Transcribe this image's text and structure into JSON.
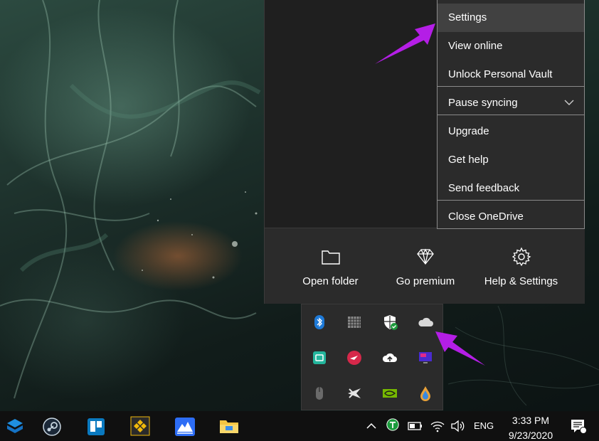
{
  "onedrive_menu": {
    "items": [
      {
        "label": "Settings"
      },
      {
        "label": "View online"
      },
      {
        "label": "Unlock Personal Vault"
      },
      {
        "label": "Pause syncing"
      },
      {
        "label": "Upgrade"
      },
      {
        "label": "Get help"
      },
      {
        "label": "Send feedback"
      },
      {
        "label": "Close OneDrive"
      }
    ]
  },
  "onedrive_footer": {
    "buttons": [
      {
        "label": "Open folder",
        "icon": "folder-icon"
      },
      {
        "label": "Go premium",
        "icon": "diamond-icon"
      },
      {
        "label": "Help & Settings",
        "icon": "gear-icon"
      }
    ]
  },
  "tray_overflow": {
    "icons": [
      "bluetooth-icon",
      "grid-app-icon",
      "security-shield-icon",
      "onedrive-cloud-icon",
      "green-app-icon",
      "red-app-icon",
      "cloud-upload-icon",
      "gpu-monitor-icon",
      "mouse-icon",
      "plane-icon",
      "nvidia-icon",
      "droplet-icon"
    ]
  },
  "taskbar": {
    "apps": [
      "virtualbox-icon",
      "steam-icon",
      "trello-icon",
      "binance-icon",
      "mountain-app-icon",
      "file-explorer-icon"
    ],
    "system": {
      "language": "ENG",
      "time": "3:33 PM",
      "date": "9/23/2020"
    }
  },
  "colors": {
    "annotation_arrow": "#b41ee6",
    "menu_background": "#2b2b2b",
    "panel_background": "#1f1f1f",
    "taskbar_background": "#101010"
  }
}
